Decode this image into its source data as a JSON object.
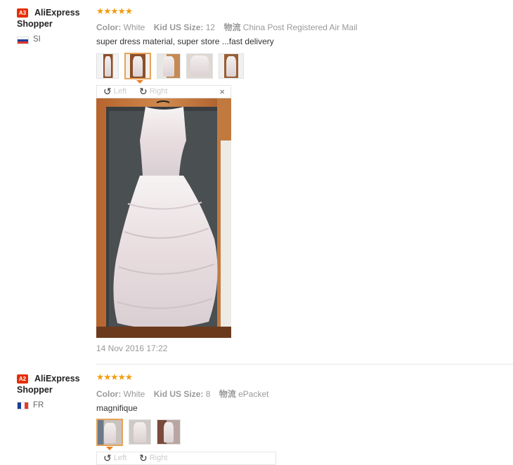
{
  "reviews": [
    {
      "badge": "A3",
      "user": "AliExpress Shopper",
      "country": "SI",
      "rating": 5,
      "stars": "★★★★★",
      "color_label": "Color:",
      "color_value": "White",
      "size_label": "Kid US Size:",
      "size_value": "12",
      "ship_label": "物流",
      "ship_value": "China Post Registered Air Mail",
      "comment": "super dress material, super store ...fast delivery",
      "viewer": {
        "left": "Left",
        "right": "Right",
        "close": "×"
      },
      "date": "14 Nov 2016 17:22"
    },
    {
      "badge": "A2",
      "user": "AliExpress Shopper",
      "country": "FR",
      "rating": 5,
      "stars": "★★★★★",
      "color_label": "Color:",
      "color_value": "White",
      "size_label": "Kid US Size:",
      "size_value": "8",
      "ship_label": "物流",
      "ship_value": "ePacket",
      "comment": "magnifique",
      "viewer": {
        "left": "Left",
        "right": "Right"
      }
    }
  ],
  "colors": {
    "badge": "#e62e04",
    "stars": "#f29c11",
    "active_thumb": "#e5a35b"
  },
  "icons": {
    "rotate_left": "rotate-left-icon",
    "rotate_right": "rotate-right-icon",
    "close": "close-icon"
  }
}
